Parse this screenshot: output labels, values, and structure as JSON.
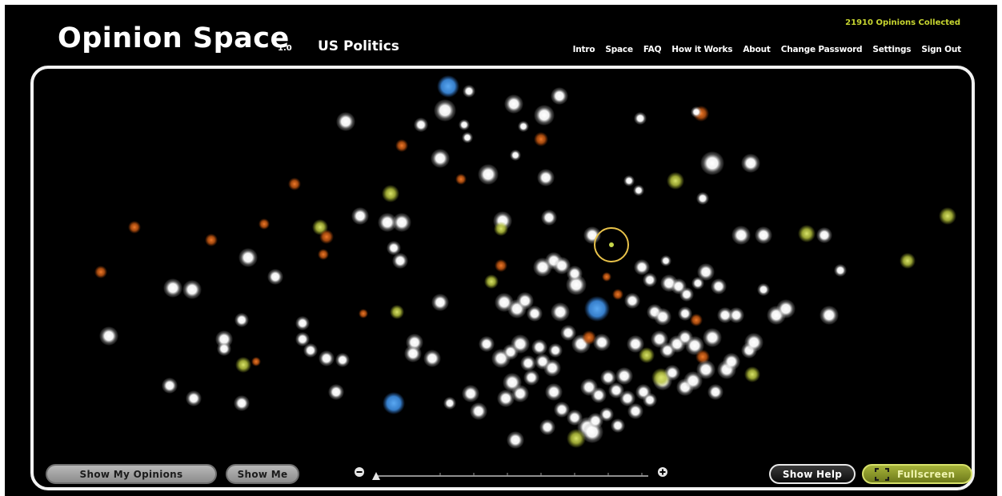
{
  "header": {
    "logo": "Opinion Space",
    "version": "1.0",
    "topic": "US Politics",
    "opinions_count": "21910 Opinions Collected"
  },
  "nav": [
    {
      "label": "Intro"
    },
    {
      "label": "Space"
    },
    {
      "label": "FAQ"
    },
    {
      "label": "How it Works"
    },
    {
      "label": "About"
    },
    {
      "label": "Change Password"
    },
    {
      "label": "Settings"
    },
    {
      "label": "Sign Out"
    }
  ],
  "controls": {
    "show_my_opinions": "Show My Opinions",
    "show_me": "Show Me",
    "show_help": "Show Help",
    "fullscreen": "Fullscreen",
    "zoom_level": 0,
    "zoom_out_icon": "minus-circle-icon",
    "zoom_in_icon": "plus-circle-icon"
  },
  "colors": {
    "background": "#000000",
    "neutral_dot": "#ffffff",
    "agree_dot": "#c6d64a",
    "disagree_dot": "#e0641c",
    "highlight_dot": "#3a86d6",
    "self_marker": "#e8c24a",
    "count_text": "#c8d630"
  }
}
